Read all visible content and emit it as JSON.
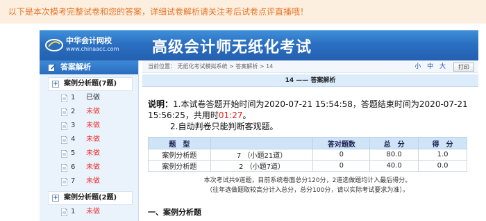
{
  "notice": "以下是本次模考完整试卷和您的答案，详细试卷解析请关注考后试卷点评直播哦！",
  "banner": {
    "logo_cn": "中华会计网校",
    "logo_en": "www.chinaacc.com",
    "title": "高级会计师无纸化考试"
  },
  "sidebar": {
    "header": "答案解析",
    "groups": [
      {
        "label": "案例分析题(7题)",
        "toggle": "+"
      },
      {
        "label": "案例分析题(2题)",
        "toggle": "+"
      }
    ],
    "items": [
      {
        "num": "1",
        "status": "已做"
      },
      {
        "num": "2",
        "status": "未做"
      },
      {
        "num": "3",
        "status": "未做"
      },
      {
        "num": "4",
        "status": "未做"
      },
      {
        "num": "5",
        "status": "未做"
      },
      {
        "num": "6",
        "status": "未做"
      },
      {
        "num": "7",
        "status": "未做"
      },
      {
        "num": "1",
        "status": "未做"
      }
    ]
  },
  "breadcrumb": "当前位置： 无纸化考试模拟系统 > 答案解析 > 14",
  "font_size": "小 中 大",
  "print_label": "打印",
  "page_head": "14 —— 答案解析",
  "intro": {
    "label": "说明：",
    "line1a": "1.本试卷答题开始时间为2020-07-21 15:54:58，答题结束时间为2020-07-21 15:56:25，共用时",
    "duration": "01:27",
    "line1b": "。",
    "line2": "2.自动判卷只能判断客观题。"
  },
  "table": {
    "headers": [
      "题　型",
      "",
      "答对题数",
      "总　分",
      "得　分"
    ],
    "rows": [
      [
        "案例分析题",
        "7 （小题21道）",
        "0",
        "80.0",
        "1.0"
      ],
      [
        "案例分析题",
        "2 （小题7道）",
        "0",
        "40.0",
        "0.0"
      ]
    ]
  },
  "footnote1": "本次考试共9道题，目前系统卷面总分120分，2道选做题均计入最后得分。",
  "footnote2": "（往年选做题取较高分计入总分，总分100分，请以实际考试要求为准）。",
  "section_title": "一、案例分析题",
  "colors": {
    "notice_bg": "#fdefe0",
    "notice_text": "#e7762a",
    "banner": "#2b6fc2",
    "undone": "#e33333",
    "time": "#e02020"
  }
}
